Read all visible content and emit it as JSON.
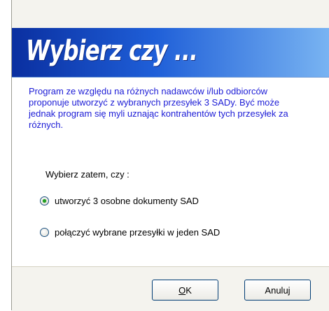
{
  "dialog": {
    "title": "Wybierz czy ...",
    "message": "Program ze względu na różnych nadawców i/lub odbiorców proponuje utworzyć z wybranych przesyłek 3 SADy. Być może jednak program się myli uznając kontrahentów tych przesyłek za różnych.",
    "prompt": "Wybierz zatem, czy :",
    "options": [
      {
        "label": "utworzyć 3 osobne dokumenty SAD",
        "selected": true
      },
      {
        "label": "połączyć wybrane przesyłki w jeden SAD",
        "selected": false
      }
    ],
    "buttons": {
      "ok_mnemonic": "O",
      "ok_rest": "K",
      "cancel": "Anuluj"
    }
  },
  "colors": {
    "message_text": "#1b1bd6",
    "banner_start": "#0a2fa0",
    "banner_end": "#79b4f2"
  }
}
